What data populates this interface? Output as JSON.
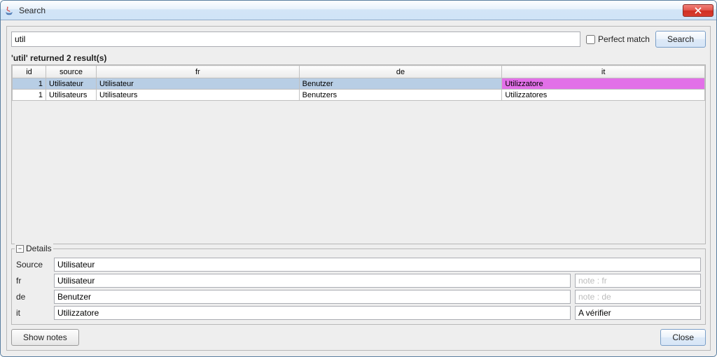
{
  "window": {
    "title": "Search"
  },
  "search": {
    "value": "util",
    "perfect_match_label": "Perfect match",
    "perfect_match_checked": false,
    "button_label": "Search"
  },
  "status": "'util' returned 2 result(s)",
  "table": {
    "headers": {
      "id": "id",
      "source": "source",
      "fr": "fr",
      "de": "de",
      "it": "it"
    },
    "rows": [
      {
        "id": "1",
        "source": "Utilisateur",
        "fr": "Utilisateur",
        "de": "Benutzer",
        "it": "Utilizzatore",
        "selected": true,
        "it_highlight": true
      },
      {
        "id": "1",
        "source": "Utilisateurs",
        "fr": "Utilisateurs",
        "de": "Benutzers",
        "it": "Utilizzatores",
        "selected": false
      }
    ]
  },
  "details": {
    "title": "Details",
    "labels": {
      "source": "Source",
      "fr": "fr",
      "de": "de",
      "it": "it"
    },
    "values": {
      "source": "Utilisateur",
      "fr": "Utilisateur",
      "de": "Benutzer",
      "it": "Utilizzatore"
    },
    "notes": {
      "fr_placeholder": "note : fr",
      "de_placeholder": "note : de",
      "it_value": "A vérifier"
    }
  },
  "buttons": {
    "show_notes": "Show notes",
    "close": "Close"
  }
}
